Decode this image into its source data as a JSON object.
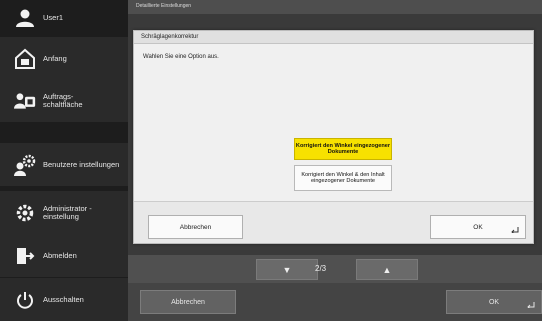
{
  "sidebar": {
    "items": [
      {
        "label": "User1",
        "icon": "user-icon"
      },
      {
        "label": "Anfang",
        "icon": "home-icon"
      },
      {
        "label": "Auftrags-\nschaltfläche",
        "icon": "job-button-icon"
      },
      {
        "label": "Benutzere instellungen",
        "icon": "user-settings-icon"
      },
      {
        "label": "Administrator -\neinstellung",
        "icon": "admin-settings-icon"
      },
      {
        "label": "Abmelden",
        "icon": "logout-icon"
      },
      {
        "label": "Ausschalten",
        "icon": "power-icon"
      }
    ]
  },
  "background": {
    "header_title": "Detaillierte Einstellungen",
    "pager": {
      "page": "2/3",
      "down_icon": "triangle-down-icon",
      "up_icon": "triangle-up-icon"
    },
    "cancel_label": "Abbrechen",
    "ok_label": "OK"
  },
  "dialog": {
    "title": "Schräglagenkorrektur",
    "instruction": "Wahlen Sie eine Option aus.",
    "options": [
      {
        "label": "Korrigiert den Winkel eingezogener Dokumente",
        "selected": true
      },
      {
        "label": "Korrigiert den Winkel & den Inhalt eingezogener Dokumente",
        "selected": false
      }
    ],
    "cancel_label": "Abbrechen",
    "ok_label": "OK"
  },
  "colors": {
    "selected_option": "#f7e100",
    "sidebar_bg": "#1d1d1d",
    "sidebar_item": "#2a2a2a"
  }
}
